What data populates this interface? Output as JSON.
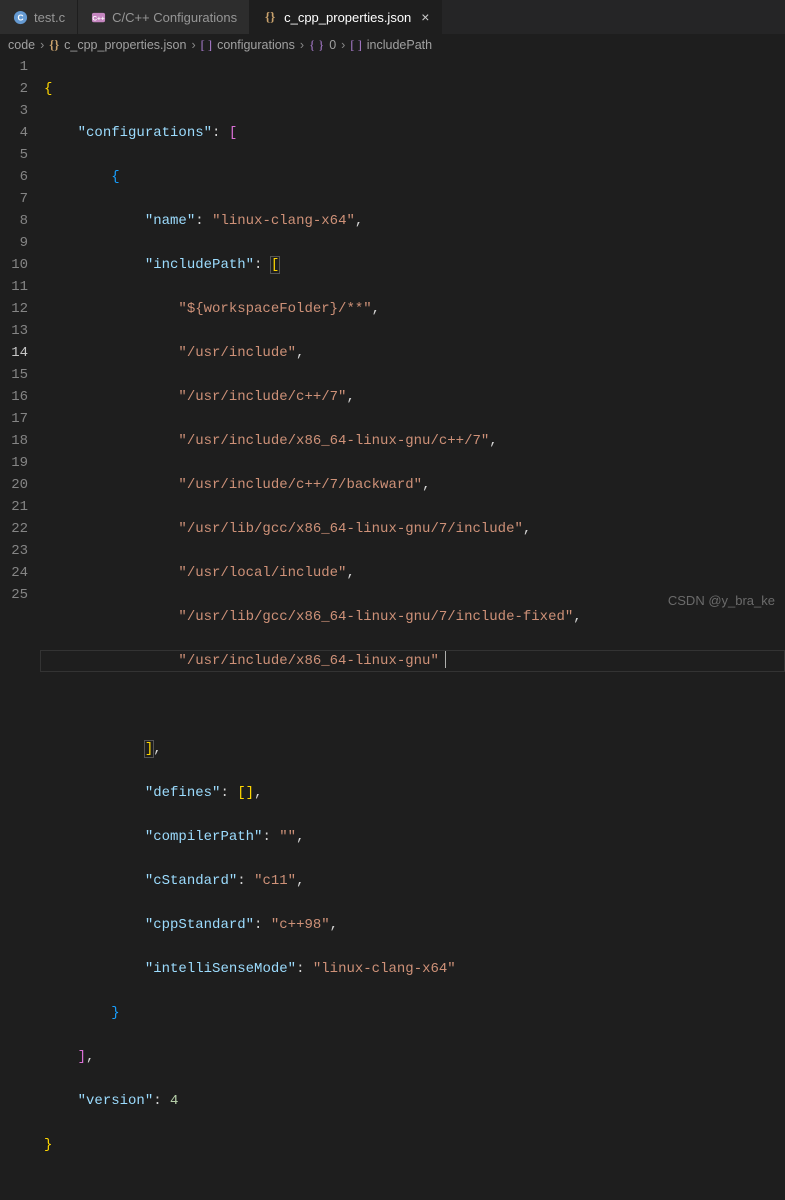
{
  "tabs": {
    "t1": {
      "label": "test.c"
    },
    "t2": {
      "label": "C/C++ Configurations"
    },
    "t3": {
      "label": "c_cpp_properties.json",
      "close": "×"
    }
  },
  "breadcrumbs": {
    "b0": "code",
    "b1": "c_cpp_properties.json",
    "b2": "configurations",
    "b3": "0",
    "b4": "includePath"
  },
  "code": {
    "key_configurations": "\"configurations\"",
    "key_name": "\"name\"",
    "val_name": "\"linux-clang-x64\"",
    "key_includePath": "\"includePath\"",
    "inc0": "\"${workspaceFolder}/**\"",
    "inc1": "\"/usr/include\"",
    "inc2": "\"/usr/include/c++/7\"",
    "inc3": "\"/usr/include/x86_64-linux-gnu/c++/7\"",
    "inc4": "\"/usr/include/c++/7/backward\"",
    "inc5": "\"/usr/lib/gcc/x86_64-linux-gnu/7/include\"",
    "inc6": "\"/usr/local/include\"",
    "inc7": "\"/usr/lib/gcc/x86_64-linux-gnu/7/include-fixed\"",
    "inc8": "\"/usr/include/x86_64-linux-gnu\"",
    "key_defines": "\"defines\"",
    "key_compilerPath": "\"compilerPath\"",
    "val_compilerPath": "\"\"",
    "key_cStandard": "\"cStandard\"",
    "val_cStandard": "\"c11\"",
    "key_cppStandard": "\"cppStandard\"",
    "val_cppStandard": "\"c++98\"",
    "key_intelliSenseMode": "\"intelliSenseMode\"",
    "val_intelliSenseMode": "\"linux-clang-x64\"",
    "key_version": "\"version\"",
    "val_version": "4"
  },
  "watermark": "CSDN @y_bra_ke",
  "chart_data": {
    "type": "table",
    "title": "c_cpp_properties.json",
    "configurations": [
      {
        "name": "linux-clang-x64",
        "includePath": [
          "${workspaceFolder}/**",
          "/usr/include",
          "/usr/include/c++/7",
          "/usr/include/x86_64-linux-gnu/c++/7",
          "/usr/include/c++/7/backward",
          "/usr/lib/gcc/x86_64-linux-gnu/7/include",
          "/usr/local/include",
          "/usr/lib/gcc/x86_64-linux-gnu/7/include-fixed",
          "/usr/include/x86_64-linux-gnu"
        ],
        "defines": [],
        "compilerPath": "",
        "cStandard": "c11",
        "cppStandard": "c++98",
        "intelliSenseMode": "linux-clang-x64"
      }
    ],
    "version": 4
  }
}
